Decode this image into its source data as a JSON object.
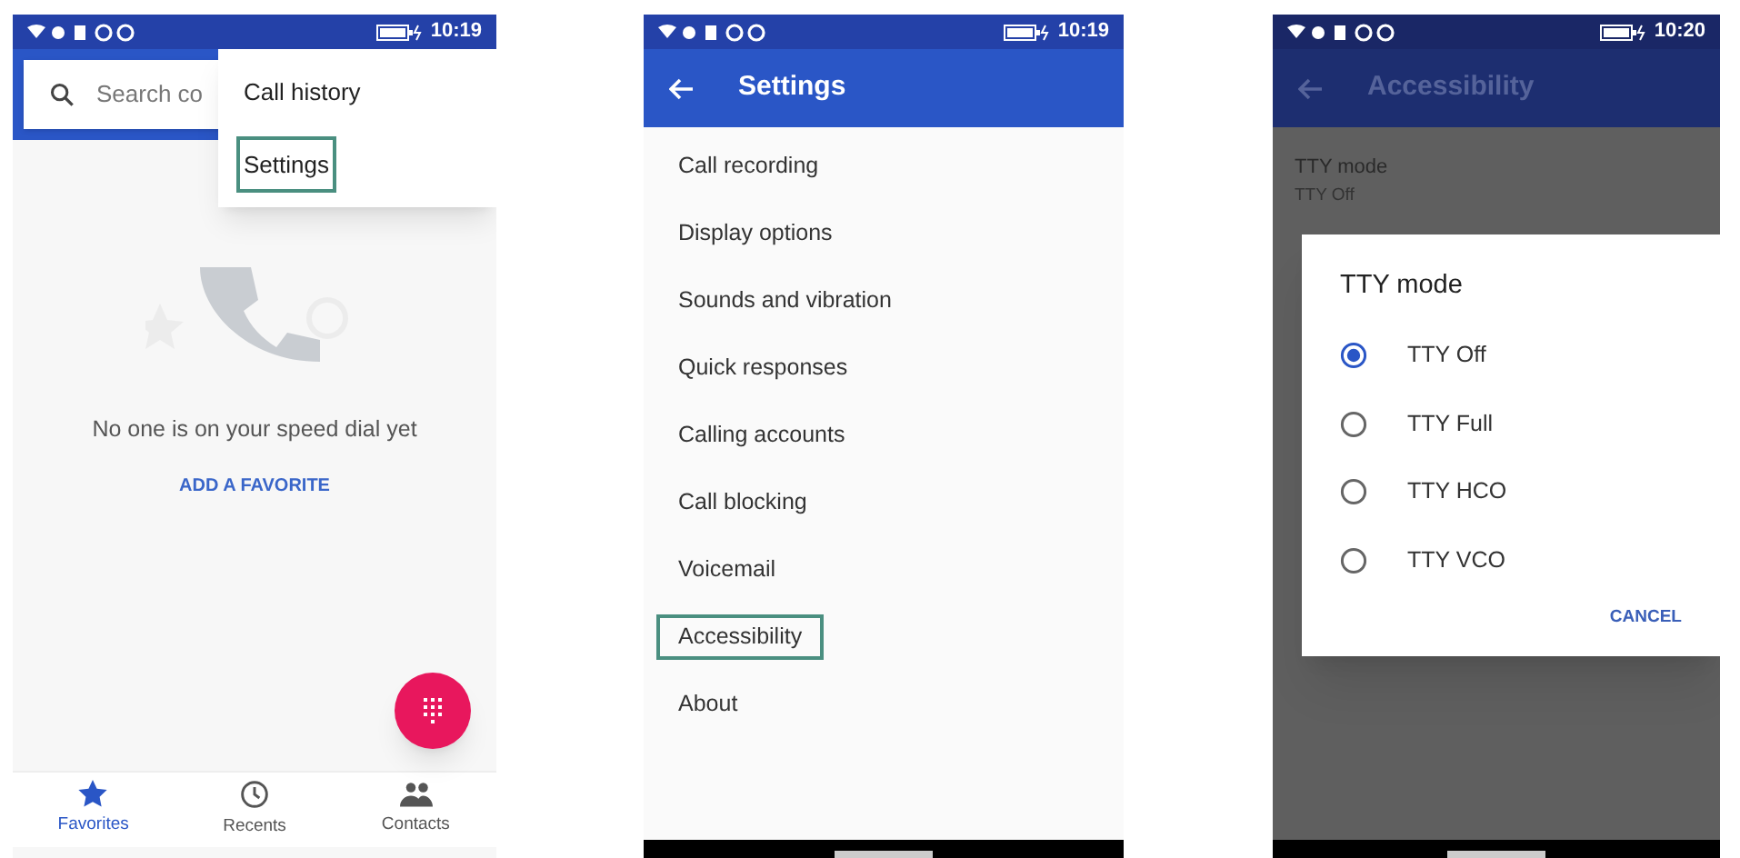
{
  "screens": [
    {
      "kind": "favorites",
      "status_bar": {
        "time": "10:19"
      },
      "search": {
        "placeholder": "Search co"
      },
      "menu": [
        {
          "label": "Call history",
          "highlighted": false
        },
        {
          "label": "Settings",
          "highlighted": true
        }
      ],
      "empty_state": {
        "message": "No one is on your speed dial yet",
        "action": "ADD A FAVORITE"
      },
      "bottom_nav": [
        {
          "label": "Favorites",
          "selected": true
        },
        {
          "label": "Recents",
          "selected": false
        },
        {
          "label": "Contacts",
          "selected": false
        }
      ]
    },
    {
      "kind": "settings",
      "status_bar": {
        "time": "10:19"
      },
      "app_bar": {
        "title": "Settings"
      },
      "items": [
        {
          "label": "Call recording",
          "highlighted": false
        },
        {
          "label": "Display options",
          "highlighted": false
        },
        {
          "label": "Sounds and vibration",
          "highlighted": false
        },
        {
          "label": "Quick responses",
          "highlighted": false
        },
        {
          "label": "Calling accounts",
          "highlighted": false
        },
        {
          "label": "Call blocking",
          "highlighted": false
        },
        {
          "label": "Voicemail",
          "highlighted": false
        },
        {
          "label": "Accessibility",
          "highlighted": true
        },
        {
          "label": "About",
          "highlighted": false
        }
      ]
    },
    {
      "kind": "dialog",
      "status_bar": {
        "time": "10:20"
      },
      "app_bar": {
        "title": "Accessibility"
      },
      "setting": {
        "title": "TTY mode",
        "value": "TTY Off"
      },
      "dialog": {
        "title": "TTY mode",
        "options": [
          {
            "label": "TTY Off",
            "selected": true
          },
          {
            "label": "TTY Full",
            "selected": false
          },
          {
            "label": "TTY HCO",
            "selected": false
          },
          {
            "label": "TTY VCO",
            "selected": false
          }
        ],
        "button": "CANCEL"
      }
    }
  ]
}
